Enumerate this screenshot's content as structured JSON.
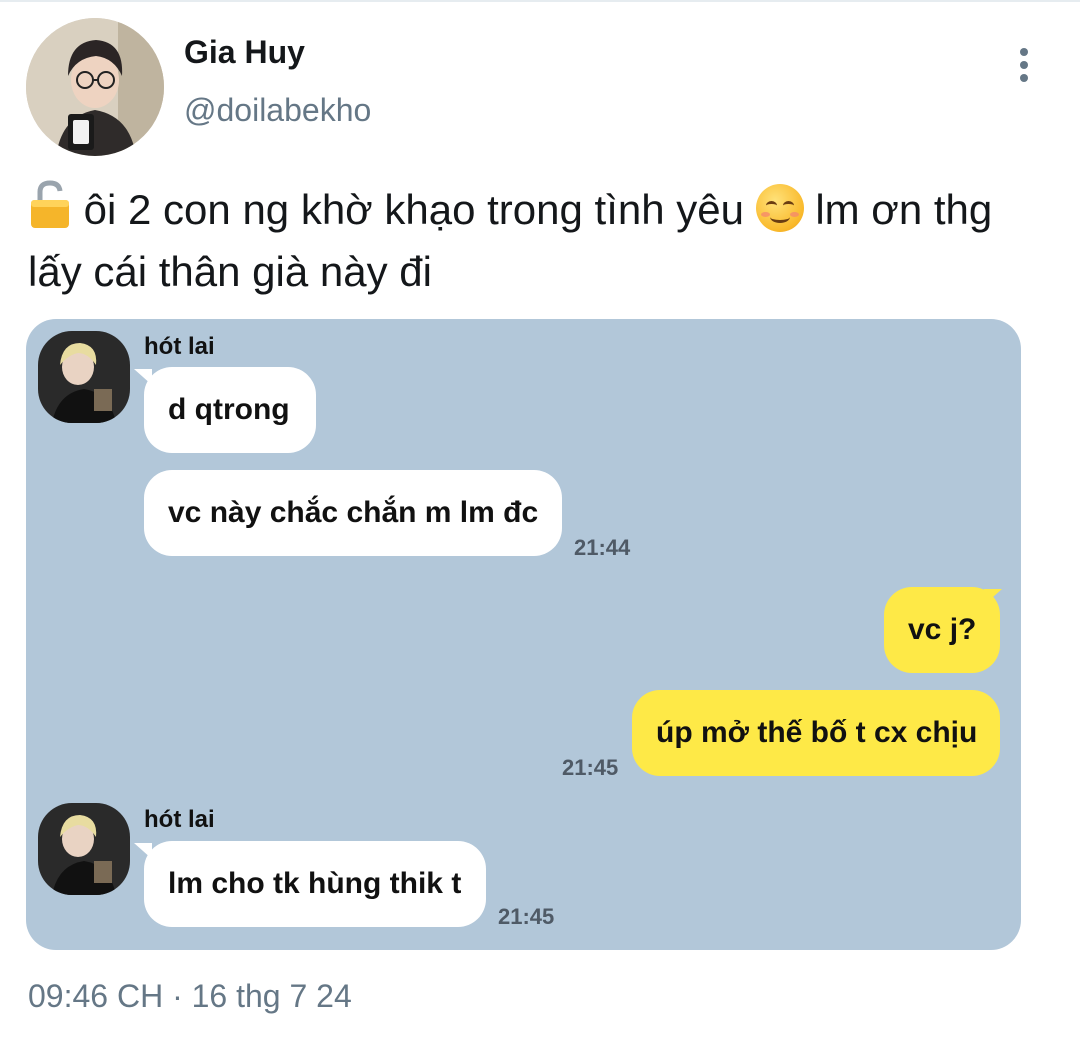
{
  "author": {
    "name": "Gia Huy",
    "handle": "@doilabekho",
    "avatar_icon": "profile-photo"
  },
  "more_icon": "more-vertical-icon",
  "tweet": {
    "lock_emoji": "🔓",
    "text_part1": " ôi 2 con ng khờ khạo trong tình yêu ",
    "smile_emoji": "☺️",
    "text_part2": " lm ơn thg lấy cái thân già này đi"
  },
  "chat": {
    "background": "#b2c7d9",
    "incoming_color": "#ffffff",
    "outgoing_color": "#fee947",
    "messages": [
      {
        "sender": "hót lai",
        "text": "d qtrong",
        "direction": "in"
      },
      {
        "text": "vc này chắc chắn m lm đc",
        "direction": "in",
        "time": "21:44"
      },
      {
        "text": "vc j?",
        "direction": "out"
      },
      {
        "text": "úp mở thế bố t cx chịu",
        "direction": "out",
        "time": "21:45"
      },
      {
        "sender": "hót lai",
        "text": "lm cho tk hùng thik t",
        "direction": "in",
        "time": "21:45"
      }
    ]
  },
  "timestamp": "09:46 CH · 16 thg 7 24"
}
